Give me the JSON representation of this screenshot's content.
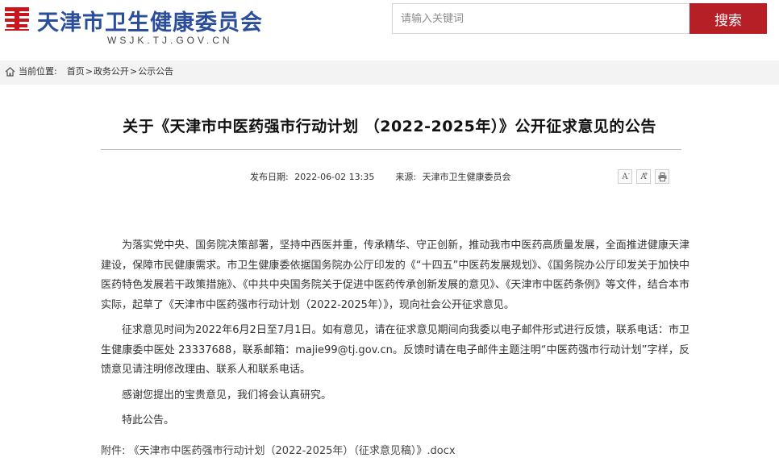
{
  "header": {
    "logo_text": "天津",
    "site_title": "天津市卫生健康委员会",
    "site_domain": "WSJK.TJ.GOV.CN",
    "search_placeholder": "请输入关键词",
    "search_button": "搜索",
    "brand_color": "#2b4e9c",
    "accent_color": "#b61f26"
  },
  "breadcrumb": {
    "label": "当前位置:",
    "items": [
      "首页",
      "政务公开",
      "公示公告"
    ],
    "separator": ">"
  },
  "article": {
    "title": "关于《天津市中医药强市行动计划 （2022-2025年）》公开征求意见的公告",
    "publish_label": "发布日期:",
    "publish_date": "2022-06-02 13:35",
    "source_label": "来源:",
    "source": "天津市卫生健康委员会",
    "tools": {
      "font_smaller": "A",
      "font_larger": "A",
      "print_icon": "print-icon"
    },
    "paragraphs": [
      "为落实党中央、国务院决策部署，坚持中西医并重，传承精华、守正创新，推动我市中医药高质量发展，全面推进健康天津建设，保障市民健康需求。市卫生健康委依据国务院办公厅印发的《“十四五”中医药发展规划》、《国务院办公厅印发关于加快中医药特色发展若干政策措施》、《中共中央国务院关于促进中医药传承创新发展的意见》、《天津市中医药条例》等文件，结合本市实际，起草了《天津市中医药强市行动计划（2022-2025年）》，现向社会公开征求意见。",
      "征求意见时间为2022年6月2日至7月1日。如有意见，请在征求意见期间向我委以电子邮件形式进行反馈，联系电话：市卫生健康委中医处 23337688，联系邮箱：majie99@tj.gov.cn。反馈时请在电子邮件主题注明“中医药强市行动计划”字样，反馈意见请注明修改理由、联系人和联系电话。",
      "感谢您提出的宝贵意见，我们将会认真研究。",
      "特此公告。"
    ],
    "attachment_label": "附件:",
    "attachment_name": "《天津市中医药强市行动计划（2022-2025年）（征求意见稿）》.docx"
  }
}
